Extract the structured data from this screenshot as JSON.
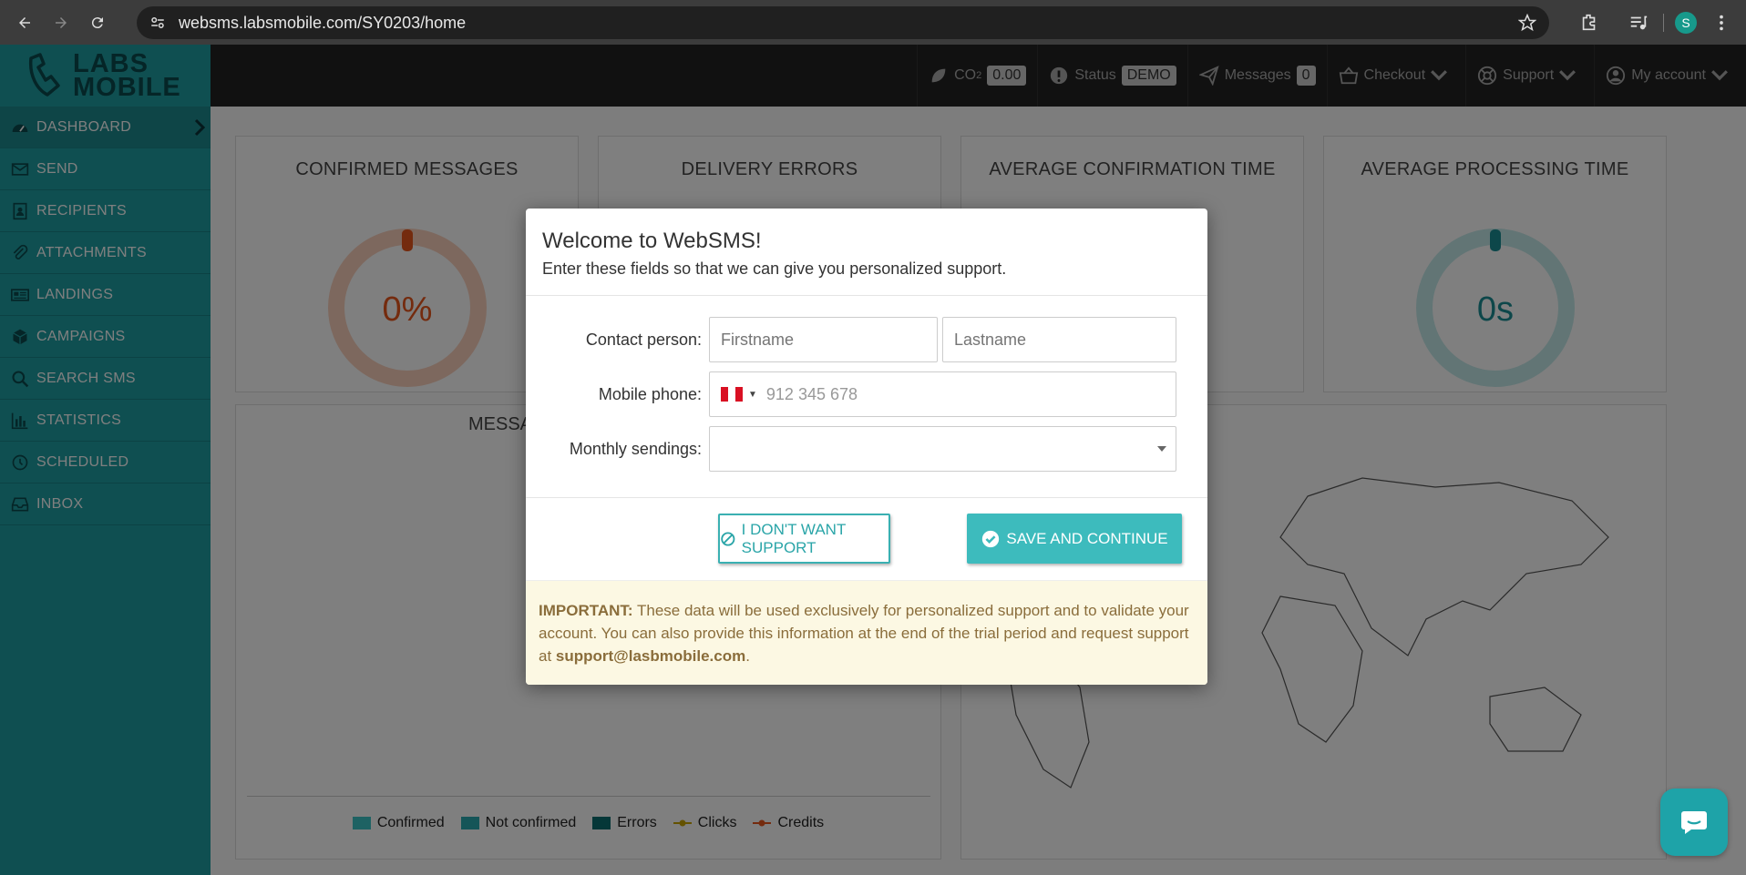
{
  "browser": {
    "url": "websms.labsmobile.com/SY0203/home",
    "avatar_letter": "S"
  },
  "logo": {
    "line1": "LABS",
    "line2": "MOBILE"
  },
  "sidebar": {
    "items": [
      {
        "label": "DASHBOARD",
        "icon": "dashboard-icon"
      },
      {
        "label": "SEND",
        "icon": "envelope-icon"
      },
      {
        "label": "RECIPIENTS",
        "icon": "contacts-icon"
      },
      {
        "label": "ATTACHMENTS",
        "icon": "paperclip-icon"
      },
      {
        "label": "LANDINGS",
        "icon": "landing-icon"
      },
      {
        "label": "CAMPAIGNS",
        "icon": "cube-icon"
      },
      {
        "label": "SEARCH SMS",
        "icon": "search-icon"
      },
      {
        "label": "STATISTICS",
        "icon": "bar-chart-icon"
      },
      {
        "label": "SCHEDULED",
        "icon": "clock-icon"
      },
      {
        "label": "INBOX",
        "icon": "inbox-icon"
      }
    ]
  },
  "topnav": {
    "co2_label": "CO",
    "co2_sub": "2",
    "co2_value": "0.00",
    "status_label": "Status",
    "status_value": "DEMO",
    "messages_label": "Messages",
    "messages_value": "0",
    "checkout_label": "Checkout",
    "support_label": "Support",
    "account_label": "My account"
  },
  "cards": {
    "confirmed_title": "CONFIRMED MESSAGES",
    "confirmed_value": "0%",
    "errors_title": "DELIVERY ERRORS",
    "avg_conf_title": "AVERAGE CONFIRMATION TIME",
    "avg_proc_title": "AVERAGE PROCESSING TIME",
    "avg_proc_value": "0s",
    "messages_partial_title": "MESSA"
  },
  "legend": [
    "Confirmed",
    "Not confirmed",
    "Errors",
    "Clicks",
    "Credits"
  ],
  "colors": {
    "sidebar": "#1f9ea2",
    "accent": "#3dbbbd",
    "confirmed_orange": "#e8571c",
    "teal_dark": "#0b6e70"
  },
  "modal": {
    "title": "Welcome to WebSMS!",
    "subtitle": "Enter these fields so that we can give you personalized support.",
    "contact_label": "Contact person:",
    "firstname_placeholder": "Firstname",
    "lastname_placeholder": "Lastname",
    "phone_label": "Mobile phone:",
    "phone_placeholder": "912 345 678",
    "monthly_label": "Monthly sendings:",
    "monthly_value": "",
    "no_support_label": "I DON'T WANT SUPPORT",
    "save_label": "SAVE AND CONTINUE",
    "note_strong": "IMPORTANT:",
    "note_text": " These data will be used exclusively for personalized support and to validate your account. You can also provide this information at the end of the trial period and request support at ",
    "note_email": "support@lasbmobile.com",
    "note_end": "."
  }
}
